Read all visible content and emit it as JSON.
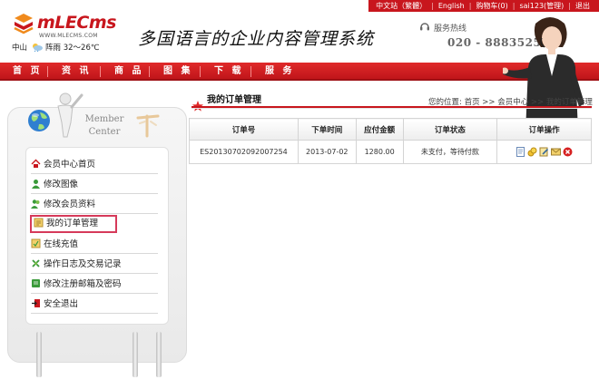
{
  "top_links": [
    "中文站（繁體）",
    "English",
    "购物车(0)",
    "sai123(管理)",
    "退出"
  ],
  "brand": {
    "logo_text": "mLECms",
    "logo_url": "WWW.MLECMS.COM"
  },
  "weather": {
    "city": "中山",
    "condition": "阵雨",
    "temp": "32～26℃"
  },
  "slogan": "多国语言的企业内容管理系统",
  "hotline": {
    "label": "服务热线",
    "number": "020 - 88835256"
  },
  "nav": [
    "首 页",
    "资 讯",
    "商 品",
    "图 集",
    "下 载",
    "服 务"
  ],
  "member_center": {
    "title_line1": "Member",
    "title_line2": "Center"
  },
  "sidebar": {
    "items": [
      {
        "label": "会员中心首页",
        "icon": "home-icon"
      },
      {
        "label": "修改图像",
        "icon": "user-icon"
      },
      {
        "label": "修改会员资料",
        "icon": "users-icon"
      },
      {
        "label": "我的订单管理",
        "icon": "order-icon"
      },
      {
        "label": "在线充值",
        "icon": "recharge-icon"
      },
      {
        "label": "操作日志及交易记录",
        "icon": "log-icon"
      },
      {
        "label": "修改注册邮箱及密码",
        "icon": "email-icon"
      },
      {
        "label": "安全退出",
        "icon": "logout-icon"
      }
    ]
  },
  "page_title": "我的订单管理",
  "breadcrumb": "您的位置: 首页 >> 会员中心 >> 我的订单管理",
  "table": {
    "headers": [
      "订单号",
      "下单时间",
      "应付金额",
      "订单状态",
      "订单操作"
    ],
    "rows": [
      {
        "order_no": "ES20130702092007254",
        "date": "2013-07-02",
        "amount": "1280.00",
        "status": "未支付，等待付款"
      }
    ]
  },
  "colors": {
    "brand_red": "#c8161d",
    "highlight_border": "#d63a5a"
  }
}
